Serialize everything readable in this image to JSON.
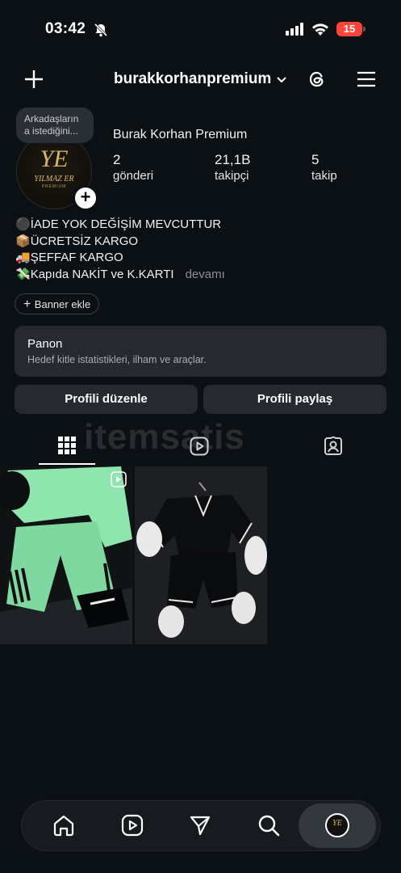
{
  "status_bar": {
    "time": "03:42",
    "battery": "15"
  },
  "header": {
    "username": "burakkorhanpremium"
  },
  "note": {
    "text": "Arkadaşların a istediğini..."
  },
  "avatar": {
    "logo_initials": "YE",
    "logo_name": "YILMAZ ER",
    "logo_sub": "PREMIUM"
  },
  "profile": {
    "display_name": "Burak Korhan Premium",
    "stats": [
      {
        "value": "2",
        "label": "gönderi"
      },
      {
        "value": "21,1B",
        "label": "takipçi"
      },
      {
        "value": "5",
        "label": "takip"
      }
    ]
  },
  "bio": {
    "lines": [
      {
        "emoji": "⚫",
        "text": "İADE YOK DEĞİŞİM MEVCUTTUR"
      },
      {
        "emoji": "📦",
        "text": "ÜCRETSİZ KARGO"
      },
      {
        "emoji": "🚚",
        "text": "ŞEFFAF KARGO"
      },
      {
        "emoji": "💸",
        "text": "Kapıda NAKİT ve K.KARTI"
      }
    ],
    "more": "devamı"
  },
  "banner_button": "Banner ekle",
  "panon": {
    "title": "Panon",
    "subtitle": "Hedef kitle istatistikleri, ilham ve araçlar."
  },
  "buttons": {
    "edit": "Profili düzenle",
    "share": "Profili paylaş"
  },
  "watermark": "itemsatis",
  "posts": [
    {
      "color": "#8ee6ae",
      "is_reel": true
    },
    {
      "color": "#111214",
      "is_reel": false
    }
  ],
  "bottom_nav": [
    "home-icon",
    "reels-icon",
    "send-icon",
    "search-icon",
    "profile-avatar"
  ]
}
